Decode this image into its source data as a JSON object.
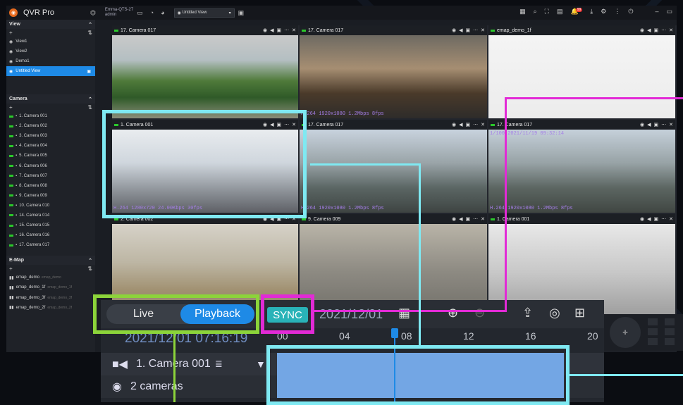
{
  "app": {
    "name": "QVR Pro",
    "server_name": "Emma-QTS-27",
    "server_user": "admin",
    "top_icons": [
      "monitor-icon",
      "cpu-icon",
      "ram-icon"
    ],
    "view_select": "Untitled View",
    "right_icons": [
      "grid-icon",
      "search-icon",
      "fullscreen-icon",
      "screen-icon",
      "bell-icon",
      "download-icon",
      "gear-icon",
      "more-icon",
      "logout-icon"
    ],
    "notification_count": "99"
  },
  "sidebar": {
    "view_header": "View",
    "views": [
      "View1",
      "View2",
      "Demo1",
      "Untitled View"
    ],
    "camera_header": "Camera",
    "cameras": [
      "1. Camera 001",
      "2. Camera 002",
      "3. Camera 003",
      "4. Camera 004",
      "5. Camera 005",
      "6. Camera 006",
      "7. Camera 007",
      "8. Camera 008",
      "9. Camera 009",
      "10. Camera 010",
      "14. Camera 014",
      "15. Camera 015",
      "16. Camera 016",
      "17. Camera 017"
    ],
    "emap_header": "E-Map",
    "emaps": [
      {
        "name": "emap_demo",
        "sub": "emap_demo"
      },
      {
        "name": "emap_demo_1f",
        "sub": "emap_demo_1f"
      },
      {
        "name": "emap_demo_3f",
        "sub": "emap_demo_3f"
      },
      {
        "name": "emap_demo_2f",
        "sub": "emap_demo_2f"
      }
    ]
  },
  "tiles": [
    {
      "title": "17. Camera 017"
    },
    {
      "title": "17. Camera 017",
      "overlay": "H.264 1920x1080 1.2Mbps 8fps"
    },
    {
      "title": "emap_demo_1f"
    },
    {
      "title": "1. Camera 001",
      "overlay": "H.264 1280x720 24.00Kbps 30fps"
    },
    {
      "title": "17. Camera 017",
      "overlay": "H.264 1920x1080 1.2Mbps 8fps"
    },
    {
      "title": "17. Camera 017",
      "overlay": "H.264 1920x1080 1.2Mbps 8fps",
      "overlay_top": "1/100 2021/11/19 09:32:14"
    },
    {
      "title": "2. Camera 002"
    },
    {
      "title": "9. Camera 009"
    },
    {
      "title": "1. Camera 001"
    }
  ],
  "playback": {
    "live_label": "Live",
    "playback_label": "Playback",
    "sync_label": "SYNC",
    "date": "2021/12/01",
    "current_time": "2021/12/01 07:16:19",
    "hour_ticks": [
      "00",
      "04",
      "08",
      "12",
      "16",
      "20"
    ],
    "row1_label": "1. Camera 001",
    "row2_label": "2 cameras",
    "cursor_hour": 7.2,
    "record_start_hour": 0,
    "record_end_hour": 18.5
  },
  "colors": {
    "accent": "#1e8ae6",
    "sync": "#29b3b8",
    "cyan_frame": "#7fe9f2",
    "magenta_frame": "#e22ad6",
    "green_frame": "#8cd43a"
  }
}
